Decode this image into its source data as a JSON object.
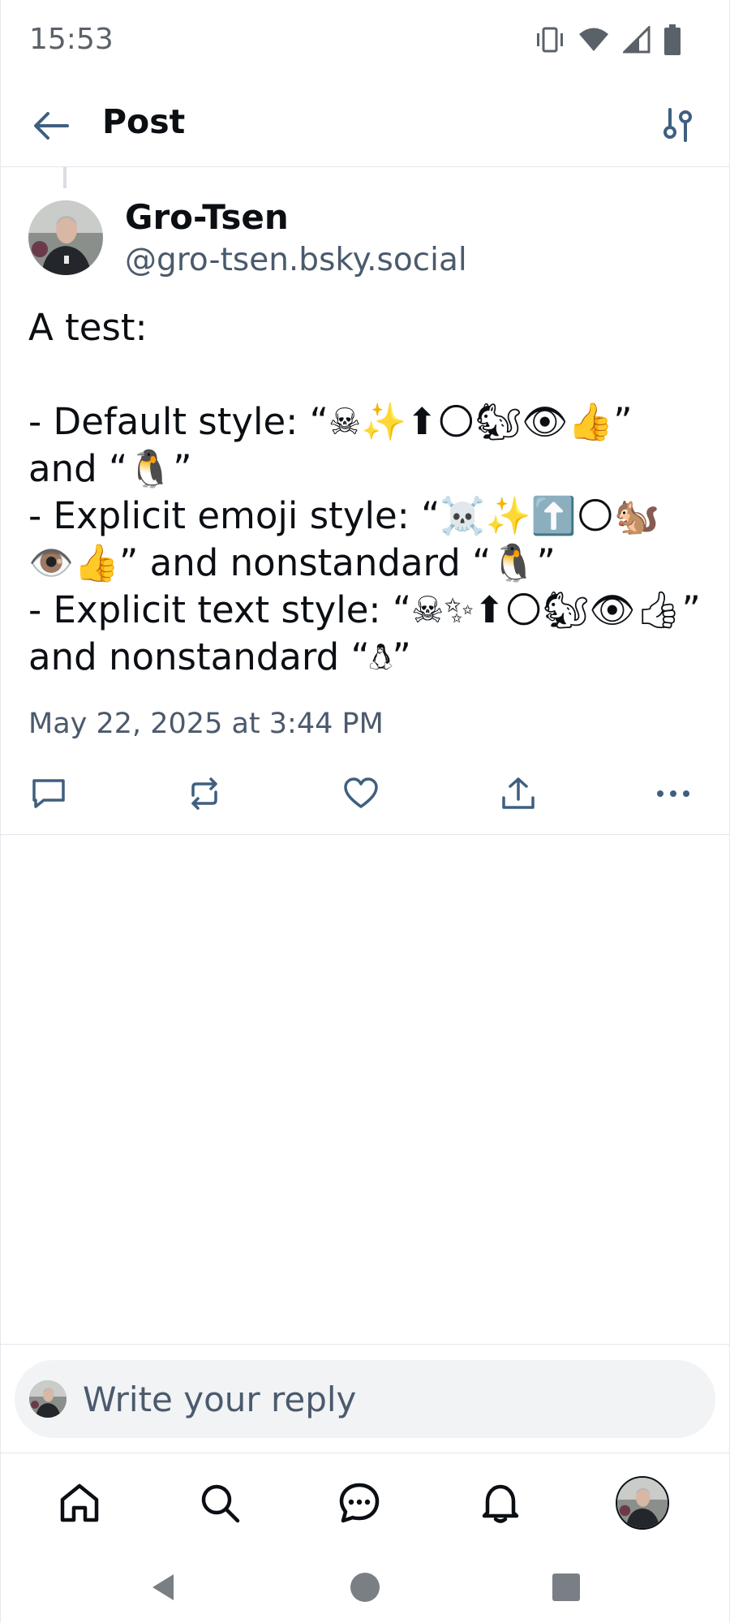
{
  "status_bar": {
    "time": "15:53",
    "icons": [
      "vibrate-icon",
      "wifi-icon",
      "cell-signal-icon",
      "battery-icon"
    ]
  },
  "header": {
    "title": "Post",
    "back_icon": "arrow-left-icon",
    "filter_icon": "sliders-icon"
  },
  "post": {
    "author": {
      "display_name": "Gro-Tsen",
      "handle": "@gro-tsen.bsky.social"
    },
    "text": "A test:\n\n- Default style: “☠✨⬆🌕🐿👁👍” and “🐧”\n- Explicit emoji style: “☠️✨⬆️🌕🐿️👁️👍” and nonstandard “🐧️”\n- Explicit text style: “☠︎✨︎⬆︎🌕︎🐿︎👁︎👍︎” and nonstandard “🐧︎”",
    "timestamp": "May 22, 2025 at 3:44 PM",
    "actions": [
      {
        "name": "reply-button",
        "icon": "speech-bubble-icon"
      },
      {
        "name": "repost-button",
        "icon": "repost-icon"
      },
      {
        "name": "like-button",
        "icon": "heart-icon"
      },
      {
        "name": "share-button",
        "icon": "share-icon"
      },
      {
        "name": "more-button",
        "icon": "ellipsis-icon"
      }
    ]
  },
  "reply_composer": {
    "placeholder": "Write your reply"
  },
  "bottom_nav": {
    "items": [
      "home-icon",
      "search-icon",
      "chat-icon",
      "bell-icon",
      "profile-avatar"
    ]
  },
  "system_nav": {
    "items": [
      "back-triangle-icon",
      "home-circle-icon",
      "recents-square-icon"
    ]
  },
  "colors": {
    "text_primary": "#0b0f14",
    "text_secondary": "#4b5a6c",
    "icon_blue_gray": "#3f5f7f",
    "divider": "#e3e7ec",
    "reply_bg": "#f1f3f5"
  }
}
